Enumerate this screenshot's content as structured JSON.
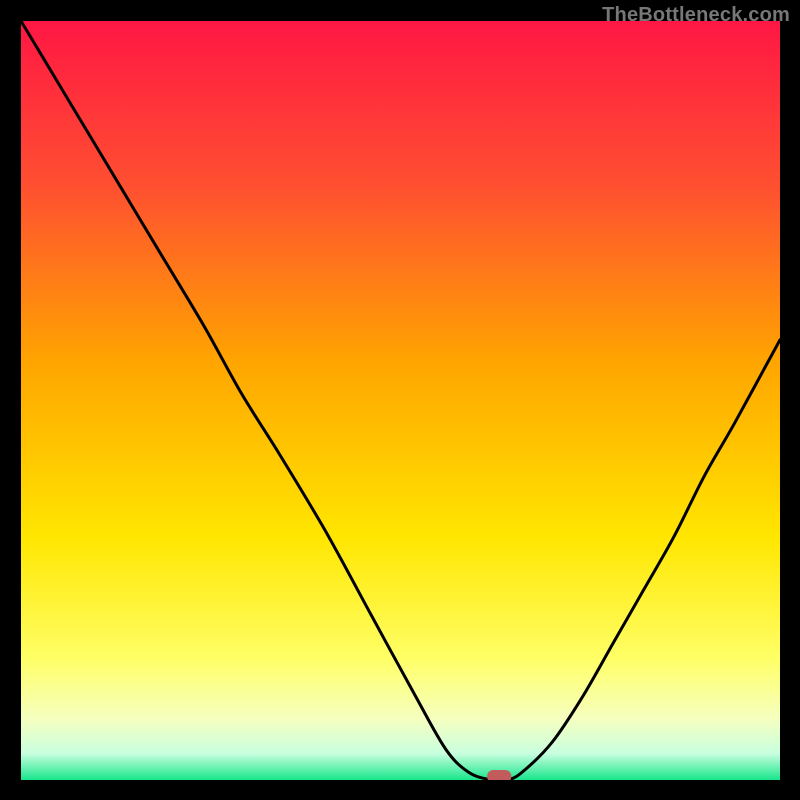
{
  "watermark": "TheBottleneck.com",
  "colors": {
    "page_bg": "#000000",
    "curve_stroke": "#000000",
    "marker_fill": "#c25b5b",
    "gradient_stops": [
      {
        "offset": 0.0,
        "color": "#ff1744"
      },
      {
        "offset": 0.22,
        "color": "#ff5030"
      },
      {
        "offset": 0.45,
        "color": "#ffa500"
      },
      {
        "offset": 0.68,
        "color": "#ffe600"
      },
      {
        "offset": 0.84,
        "color": "#ffff66"
      },
      {
        "offset": 0.92,
        "color": "#f5ffc0"
      },
      {
        "offset": 0.965,
        "color": "#c8ffde"
      },
      {
        "offset": 1.0,
        "color": "#18e68c"
      }
    ]
  },
  "chart_data": {
    "type": "line",
    "title": "",
    "xlabel": "",
    "ylabel": "",
    "xlim": [
      0,
      100
    ],
    "ylim": [
      0,
      100
    ],
    "x": [
      0,
      6,
      12,
      18,
      24,
      29,
      34,
      40,
      46,
      52,
      56,
      59,
      62,
      64,
      66,
      70,
      74,
      78,
      82,
      86,
      90,
      94,
      100
    ],
    "values": [
      100,
      90,
      80,
      70,
      60,
      51,
      43,
      33,
      22,
      11,
      4,
      1,
      0,
      0,
      1,
      5,
      11,
      18,
      25,
      32,
      40,
      47,
      58
    ],
    "marker": {
      "x": 63,
      "y": 0
    },
    "note": "x/y normalized to 0–100 plot area; curve is bottleneck % vs. relative component performance"
  }
}
